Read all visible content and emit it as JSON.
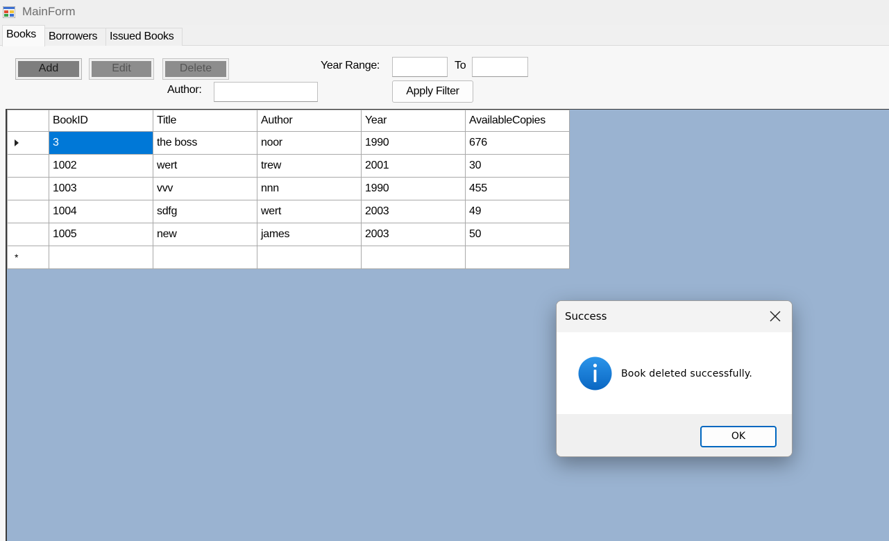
{
  "window": {
    "title": "MainForm"
  },
  "tabs": [
    {
      "label": "Books",
      "active": true
    },
    {
      "label": "Borrowers",
      "active": false
    },
    {
      "label": "Issued Books",
      "active": false
    }
  ],
  "toolbar": {
    "add_label": "Add",
    "edit_label": "Edit",
    "delete_label": "Delete"
  },
  "filters": {
    "year_range_label": "Year Range:",
    "to_label": "To",
    "author_label": "Author:",
    "year_from_value": "",
    "year_to_value": "",
    "author_value": "",
    "apply_label": "Apply Filter"
  },
  "grid": {
    "columns": [
      "BookID",
      "Title",
      "Author",
      "Year",
      "AvailableCopies"
    ],
    "rows": [
      [
        "3",
        "the boss",
        "noor",
        "1990",
        "676"
      ],
      [
        "1002",
        "wert",
        "trew",
        "2001",
        "30"
      ],
      [
        "1003",
        "vvv",
        "nnn",
        "1990",
        "455"
      ],
      [
        "1004",
        "sdfg",
        "wert",
        "2003",
        "49"
      ],
      [
        "1005",
        "new",
        "james",
        "2003",
        "50"
      ]
    ],
    "current_row_marker": "current-row-arrow-icon",
    "new_row_marker": "*"
  },
  "dialog": {
    "title": "Success",
    "message": "Book deleted successfully.",
    "ok_label": "OK",
    "icon": "info-icon",
    "icon_color": "#0a78d4"
  },
  "colors": {
    "grid_background": "#9ab3d1",
    "selection": "#0078d7"
  }
}
